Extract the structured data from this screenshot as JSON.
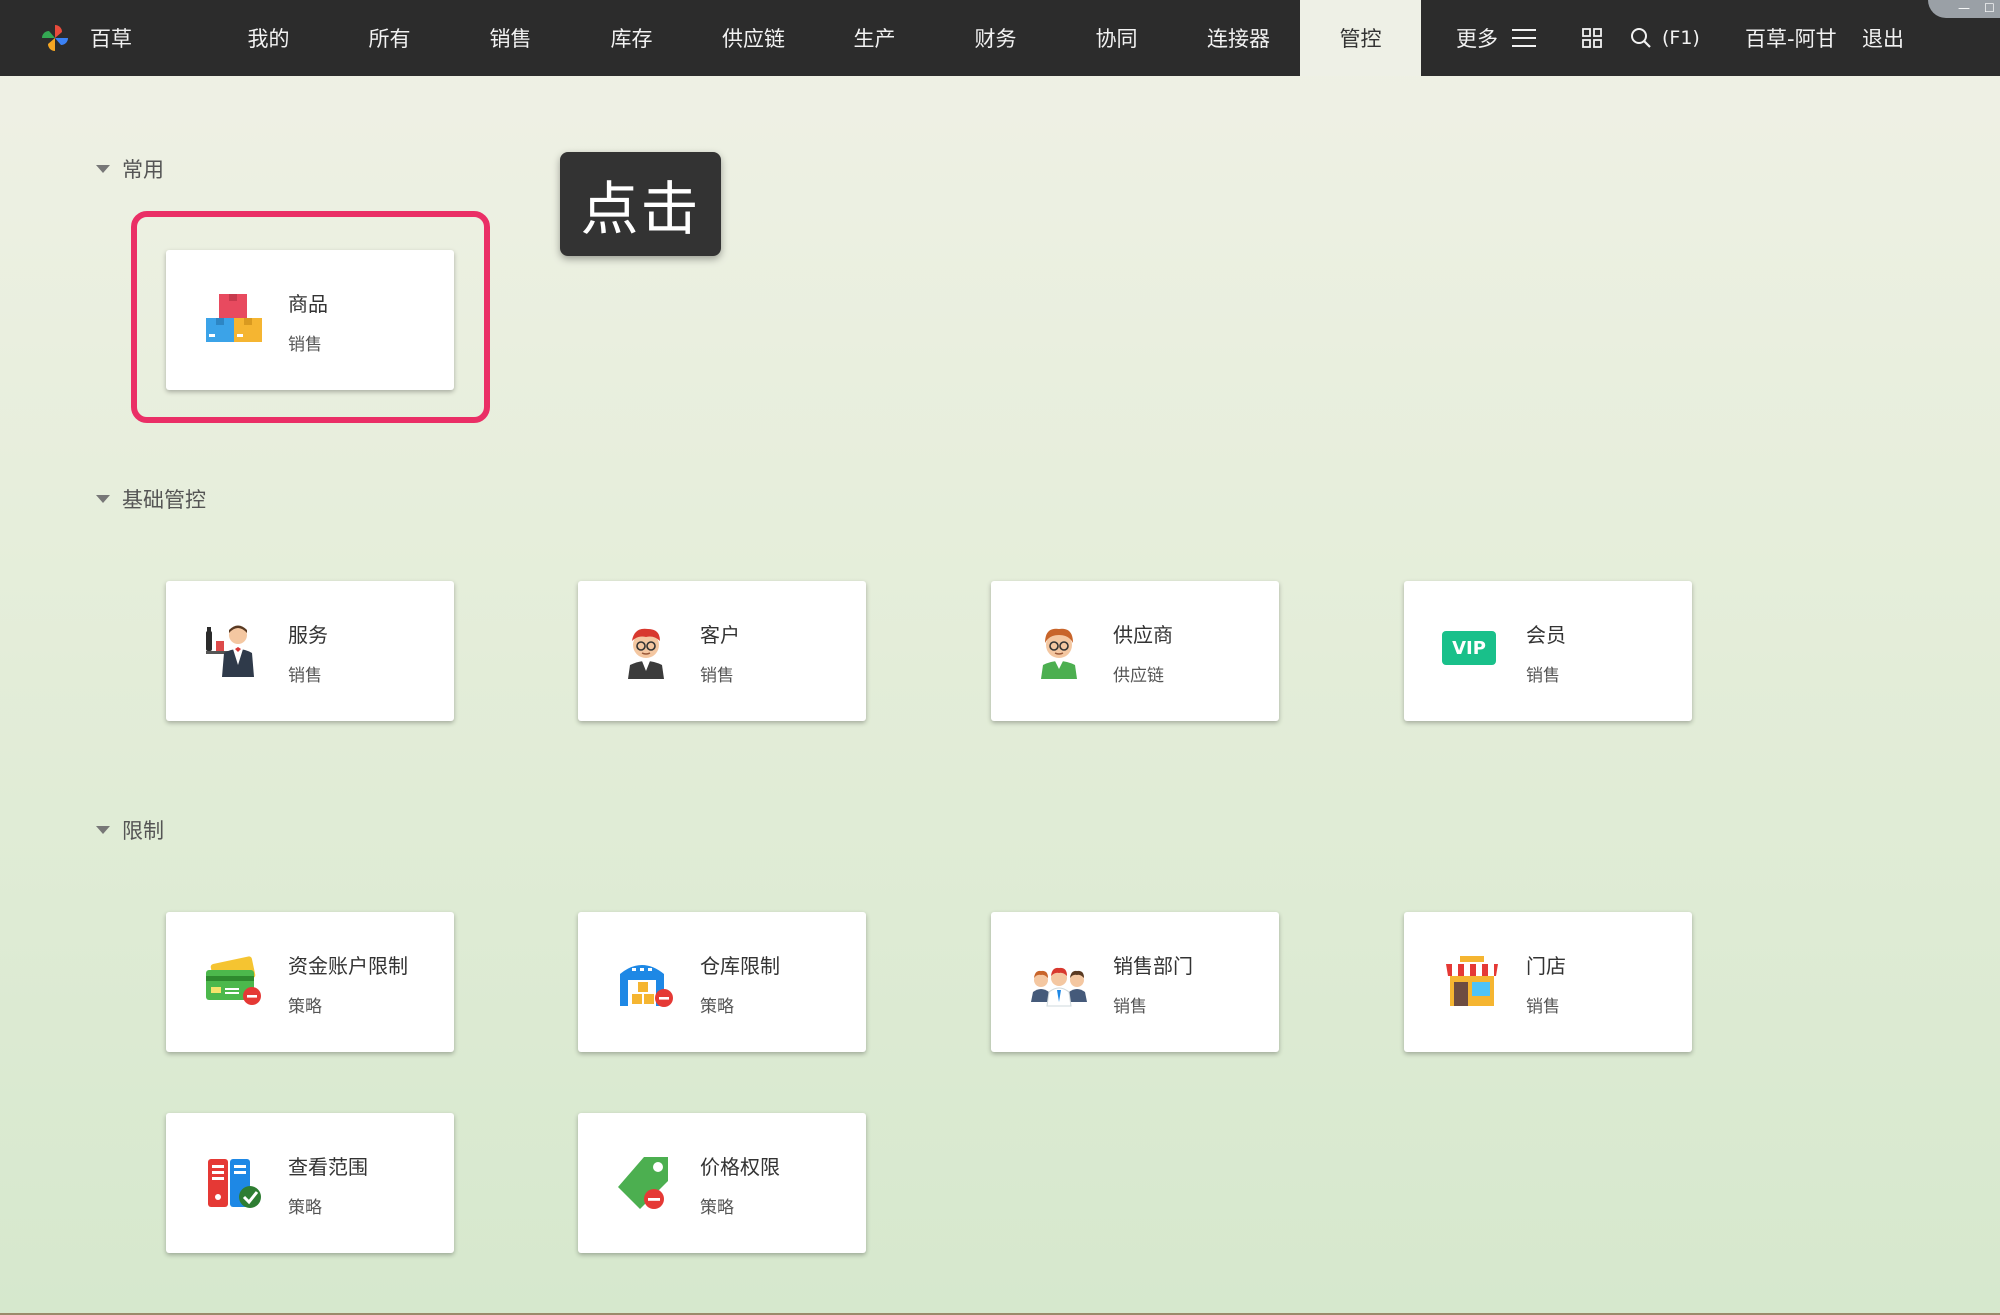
{
  "brand": {
    "name": "百草"
  },
  "nav": [
    {
      "label": "我的"
    },
    {
      "label": "所有"
    },
    {
      "label": "销售"
    },
    {
      "label": "库存"
    },
    {
      "label": "供应链"
    },
    {
      "label": "生产"
    },
    {
      "label": "财务"
    },
    {
      "label": "协同"
    },
    {
      "label": "连接器"
    },
    {
      "label": "管控",
      "active": true
    }
  ],
  "toolbar": {
    "more_label": "更多",
    "search_shortcut": "(F1)",
    "user": "百草-阿甘",
    "logout": "退出"
  },
  "tooltip": {
    "text": "点击"
  },
  "sections": [
    {
      "title": "常用",
      "cards": [
        {
          "title": "商品",
          "sub": "销售",
          "icon": "goods-boxes-icon"
        }
      ]
    },
    {
      "title": "基础管控",
      "cards": [
        {
          "title": "服务",
          "sub": "销售",
          "icon": "waiter-icon"
        },
        {
          "title": "客户",
          "sub": "销售",
          "icon": "customer-avatar-icon"
        },
        {
          "title": "供应商",
          "sub": "供应链",
          "icon": "supplier-avatar-icon"
        },
        {
          "title": "会员",
          "sub": "销售",
          "icon": "vip-badge-icon",
          "icon_text": "VIP"
        }
      ]
    },
    {
      "title": "限制",
      "cards": [
        {
          "title": "资金账户限制",
          "sub": "策略",
          "icon": "credit-card-restrict-icon"
        },
        {
          "title": "仓库限制",
          "sub": "策略",
          "icon": "warehouse-restrict-icon"
        },
        {
          "title": "销售部门",
          "sub": "销售",
          "icon": "sales-team-icon"
        },
        {
          "title": "门店",
          "sub": "销售",
          "icon": "store-front-icon"
        },
        {
          "title": "查看范围",
          "sub": "策略",
          "icon": "view-scope-icon"
        },
        {
          "title": "价格权限",
          "sub": "策略",
          "icon": "price-tag-restrict-icon"
        }
      ]
    }
  ],
  "colors": {
    "topbar": "#2c2c2c",
    "highlight": "#ea2f66",
    "vip": "#19c08a"
  }
}
